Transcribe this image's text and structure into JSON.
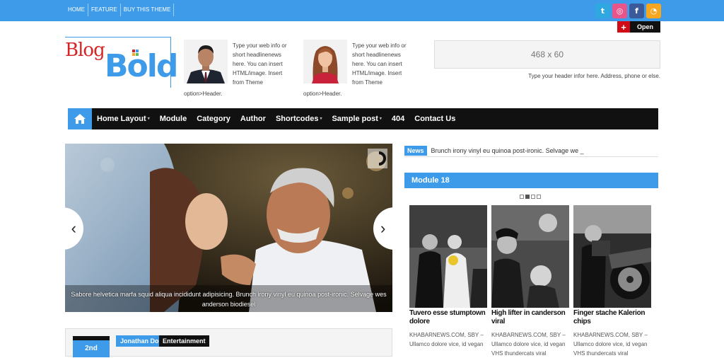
{
  "topnav": {
    "items": [
      "HOME",
      "FEATURE",
      "BUY THIS THEME"
    ]
  },
  "social": [
    {
      "name": "twitter-icon",
      "glyph": "t",
      "color": "#2fa7e0"
    },
    {
      "name": "dribbble-icon",
      "glyph": "◎",
      "color": "#e8558a"
    },
    {
      "name": "facebook-icon",
      "glyph": "f",
      "color": "#3b5a99"
    },
    {
      "name": "rss-icon",
      "glyph": "◔",
      "color": "#f7a61f"
    }
  ],
  "open_button": {
    "plus": "+",
    "label": "Open"
  },
  "logo": {
    "part1": "Blog",
    "part2": "Bold"
  },
  "profiles": [
    {
      "text": "Type your web info or short headlinenews here. You can insert HTML/image. Insert from Theme",
      "tail": "option>Header."
    },
    {
      "text": "Type your web info or short headlinenews here. You can insert HTML/image. Insert from Theme",
      "tail": "option>Header."
    }
  ],
  "ad": {
    "size": "468 x 60",
    "note": "Type your header infor here. Address, phone or else."
  },
  "mainnav": {
    "items": [
      {
        "label": "Home Layout",
        "dropdown": "▾"
      },
      {
        "label": "Module",
        "dropdown": ""
      },
      {
        "label": "Category",
        "dropdown": ""
      },
      {
        "label": "Author",
        "dropdown": ""
      },
      {
        "label": "Shortcodes",
        "dropdown": "▾"
      },
      {
        "label": "Sample post",
        "dropdown": "▾"
      },
      {
        "label": "404",
        "dropdown": ""
      },
      {
        "label": "Contact Us",
        "dropdown": ""
      }
    ]
  },
  "slider": {
    "caption": "Sabore helvetica marfa squid aliqua incididunt adipisicing. Brunch irony vinyl eu quinoa post-ironic. Selvage wes anderson biodiesel",
    "prev": "‹",
    "next": "›"
  },
  "ticker": {
    "tag": "News",
    "text": "Brunch irony vinyl eu quinoa post-ironic. Selvage we _"
  },
  "module": {
    "title": "Module 18",
    "cards": [
      {
        "title": "Tuvero esse stumptown dolore",
        "excerpt": "KHABARNEWS.COM, SBY – Ullamco dolore vice, id vegan"
      },
      {
        "title": "High lifter in canderson viral",
        "excerpt": "KHABARNEWS.COM, SBY – Ullamco dolore vice, id vegan VHS thundercats viral"
      },
      {
        "title": "Finger stache Kalerion chips",
        "excerpt": "KHABARNEWS.COM, SBY – Ullamco dolore vice, id vegan VHS thundercats viral"
      }
    ]
  },
  "bottom": {
    "date": "2nd",
    "author": "Jonathan Doe",
    "category": "Entertainment"
  }
}
